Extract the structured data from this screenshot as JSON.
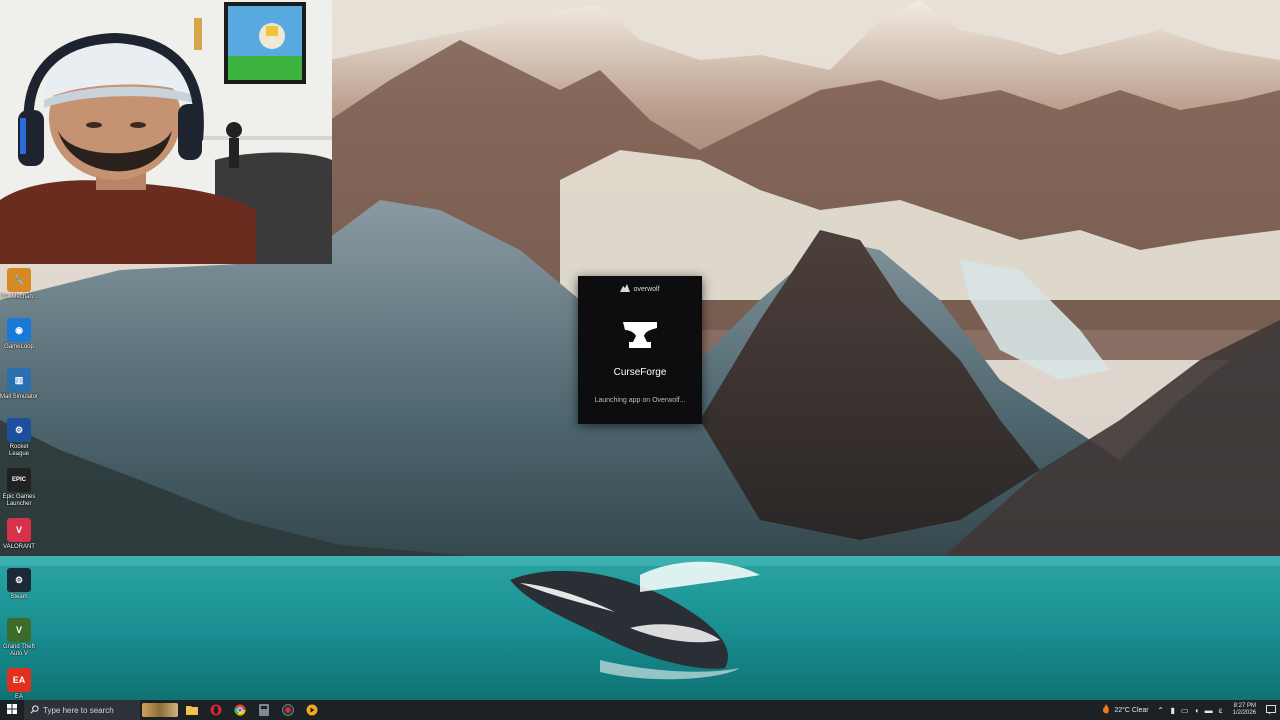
{
  "desktop": {
    "icons": [
      {
        "name": "desktop-icon-car-mechanic",
        "label": "Car Mechan...",
        "icon": "car-mechanic-icon",
        "color": "#d88a22",
        "glyph": "🔧"
      },
      {
        "name": "desktop-icon-gameloop",
        "label": "GameLoop",
        "icon": "gameloop-icon",
        "color": "#1a78d6",
        "glyph": "◉"
      },
      {
        "name": "desktop-icon-mall-simulator",
        "label": "Mall Simulator",
        "icon": "mall-simulator-icon",
        "color": "#2a6fb0",
        "glyph": "▥"
      },
      {
        "name": "desktop-icon-rocket-league",
        "label": "Rocket League",
        "icon": "rocket-league-icon",
        "color": "#1c4f9c",
        "glyph": "⚙"
      },
      {
        "name": "desktop-icon-epic-games",
        "label": "Epic Games Launcher",
        "icon": "epic-games-icon",
        "color": "#222222",
        "glyph": "EPIC"
      },
      {
        "name": "desktop-icon-valorant",
        "label": "VALORANT",
        "icon": "valorant-icon",
        "color": "#d6324a",
        "glyph": "V"
      },
      {
        "name": "desktop-icon-steam",
        "label": "Steam",
        "icon": "steam-icon",
        "color": "#1b2838",
        "glyph": "⚙"
      },
      {
        "name": "desktop-icon-gta",
        "label": "Grand Theft Auto V",
        "icon": "gta-icon",
        "color": "#3c6b2a",
        "glyph": "V"
      },
      {
        "name": "desktop-icon-ea",
        "label": "EA",
        "icon": "ea-icon",
        "color": "#e0301e",
        "glyph": "EA"
      }
    ]
  },
  "splash": {
    "brand": "overwolf",
    "app_name": "CurseForge",
    "status": "Launching app on Overwolf..."
  },
  "taskbar": {
    "search_placeholder": "Type here to search",
    "weather": "22°C  Clear",
    "time": "8:27 PM",
    "date": "1/2/2026",
    "pinned": [
      "file-explorer-icon",
      "opera-icon",
      "chrome-icon",
      "media-icon",
      "screen-recorder-icon",
      "video-player-icon"
    ]
  },
  "colors": {
    "taskbar_bg": "#1c2126",
    "splash_bg": "#0d0d0f"
  }
}
